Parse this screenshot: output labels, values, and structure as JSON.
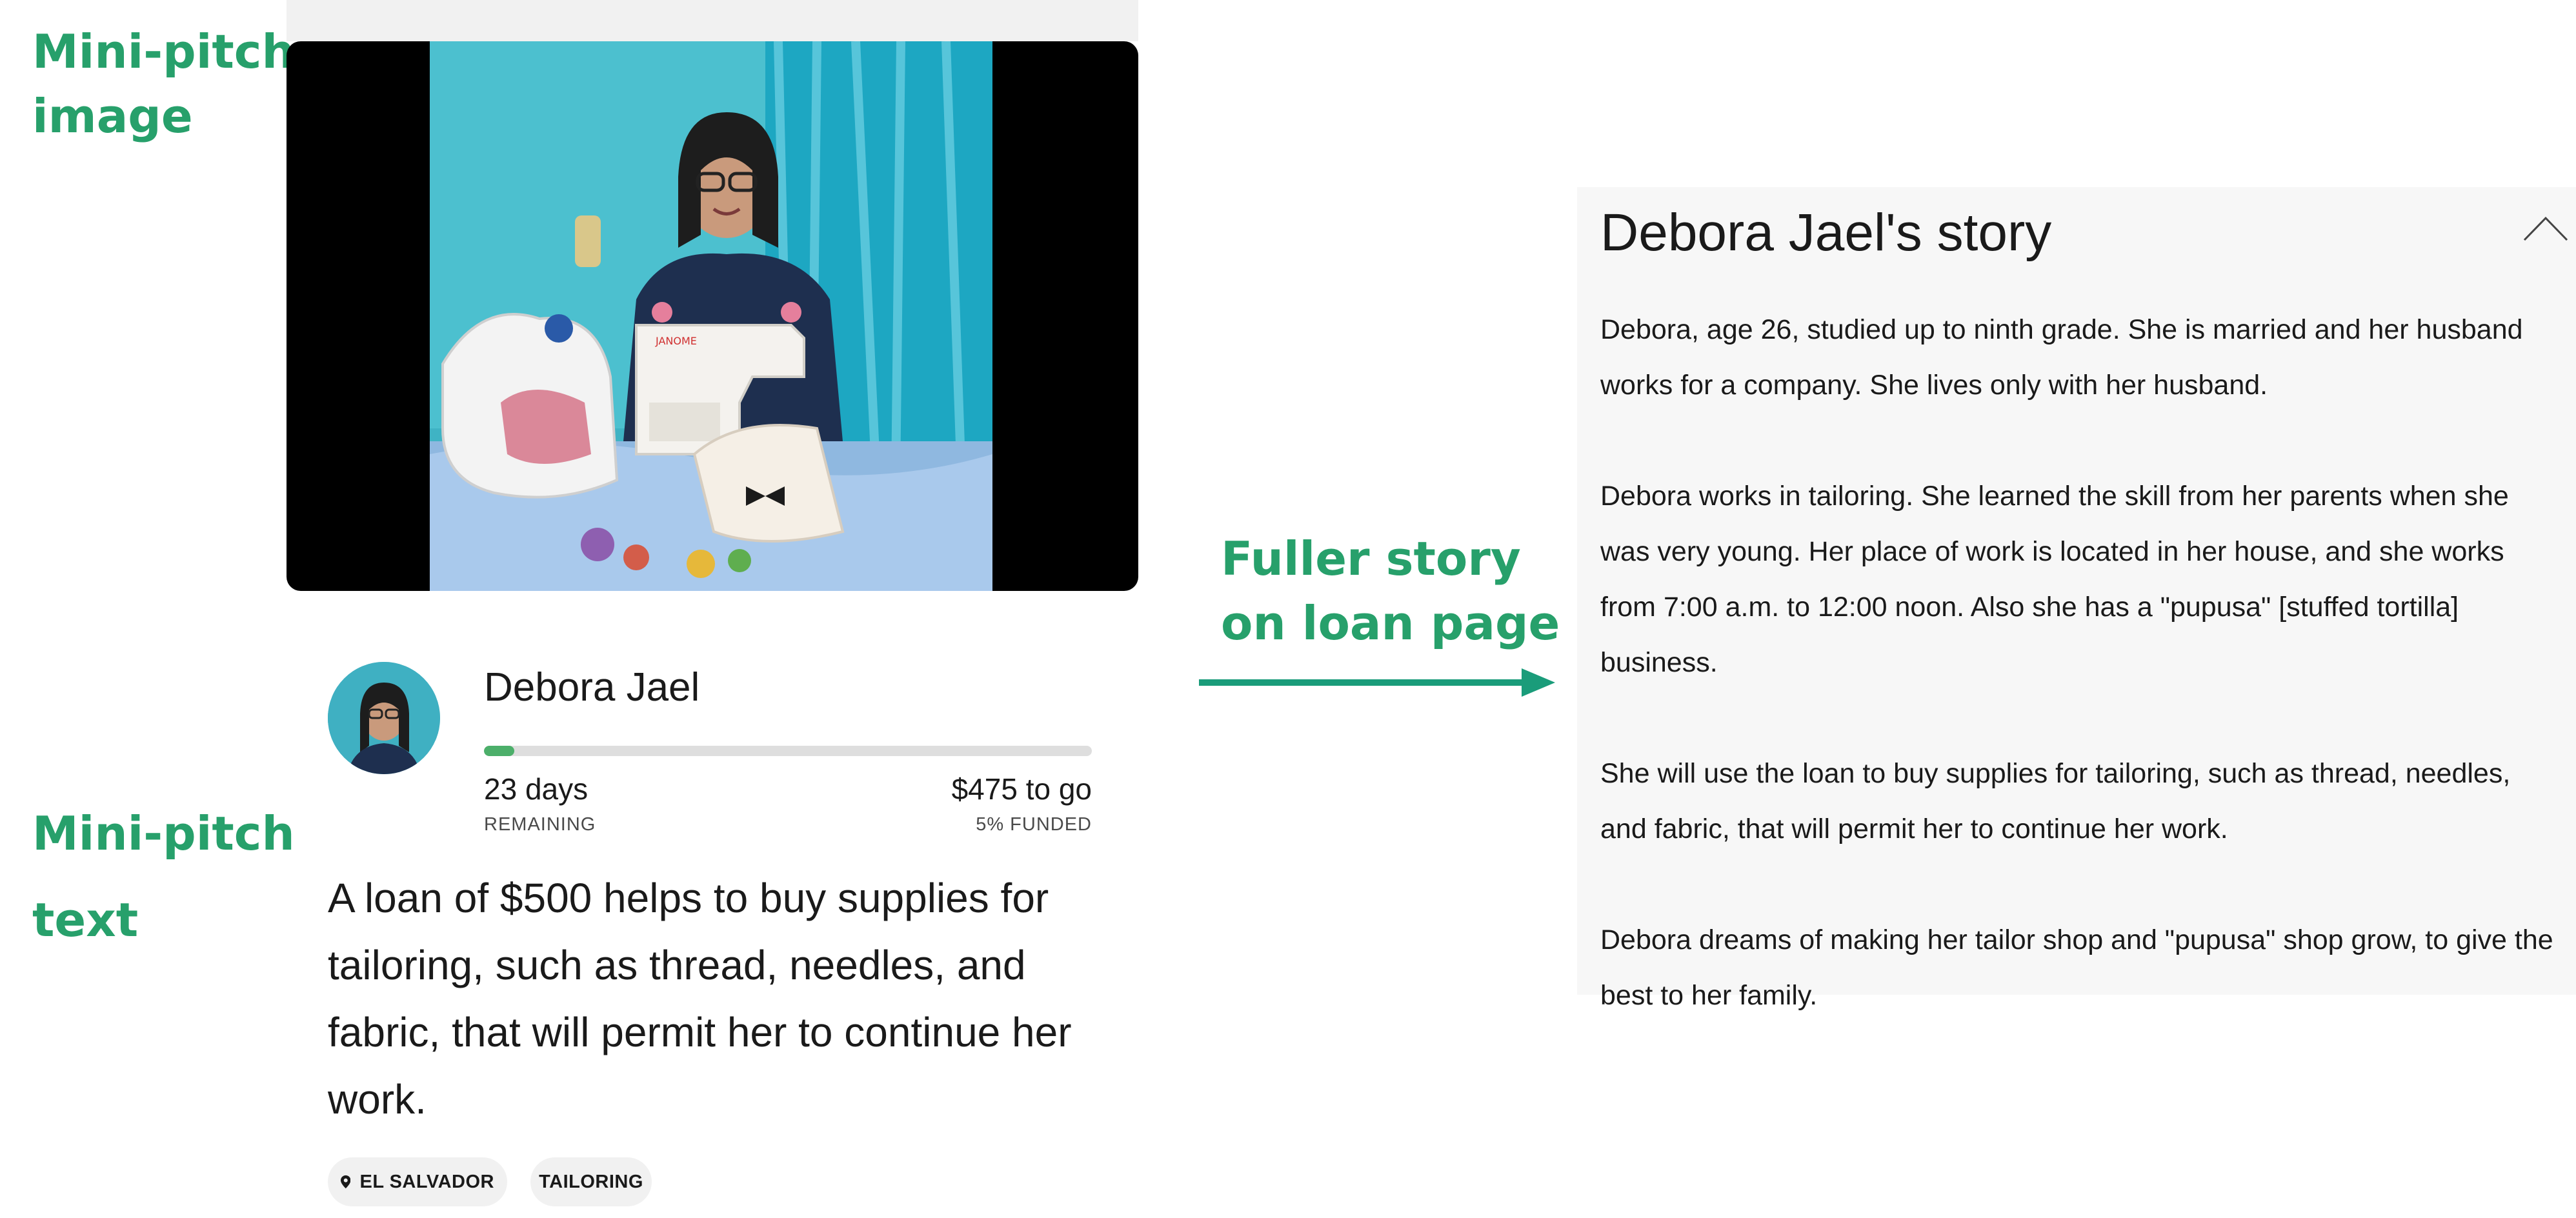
{
  "annotations": {
    "mini_pitch_image": [
      "Mini-pitch",
      "image"
    ],
    "mini_pitch_text": [
      "Mini-pitch",
      "text"
    ],
    "fuller_story": [
      "Fuller story",
      "on loan page"
    ]
  },
  "card": {
    "borrower_name": "Debora Jael",
    "funded_fraction": 0.05,
    "days_value": "23 days",
    "days_caption": "REMAINING",
    "togo_value": "$475 to go",
    "funded_caption": "5% FUNDED",
    "pitch_text": "A loan of $500 helps to buy supplies for tailoring, such as thread, needles, and fabric, that will permit her to continue her work.",
    "tags": {
      "location": "EL SALVADOR",
      "sector": "TAILORING"
    }
  },
  "story": {
    "title": "Debora Jael's story",
    "paragraphs": [
      "Debora, age 26, studied up to ninth grade. She is married and her husband works for a company. She lives only with her husband.",
      "Debora works in tailoring. She learned the skill from her parents when she was very young. Her place of work is located in her house, and she works from 7:00 a.m. to 12:00 noon. Also she has a \"pupusa\" [stuffed tortilla] business.",
      "She will use the loan to buy supplies for tailoring, such as thread, needles, and fabric, that will permit her to continue her work.",
      "Debora dreams of making her tailor shop and \"pupusa\" shop grow, to give the best to her family."
    ]
  },
  "colors": {
    "annotation_green": "#27a06b",
    "progress_green": "#4caf6a",
    "arrow_teal": "#1a9c7a"
  }
}
